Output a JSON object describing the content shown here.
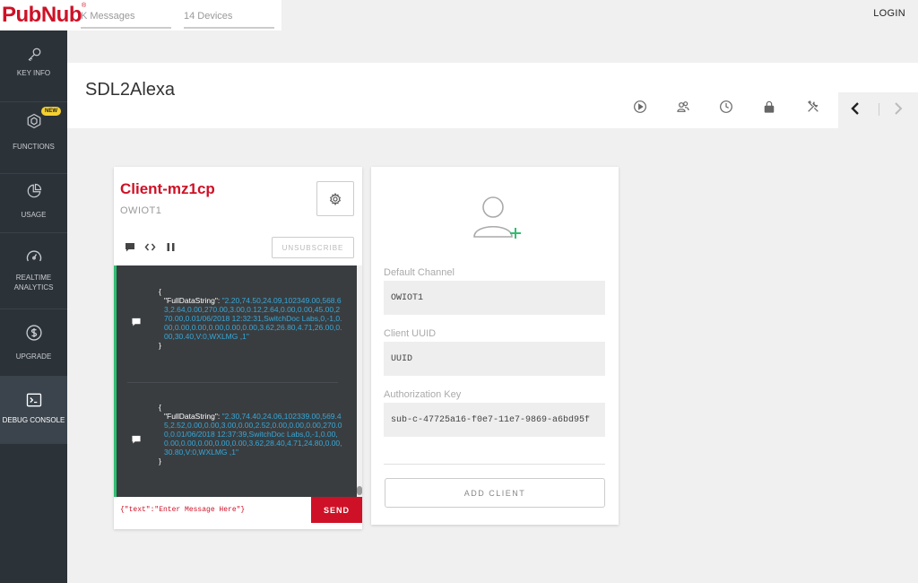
{
  "brand": {
    "logo_text": "PubNub",
    "logo_mark": "®"
  },
  "top_stats": [
    {
      "label": "K Messages"
    },
    {
      "label": "14 Devices"
    }
  ],
  "top_actions": {
    "login_label": "LOGIN"
  },
  "sidebar": {
    "items": [
      {
        "label": "KEY INFO",
        "icon": "key-icon"
      },
      {
        "label": "FUNCTIONS",
        "icon": "functions-icon",
        "badge": "NEW"
      },
      {
        "label": "USAGE",
        "icon": "pie-chart-icon"
      },
      {
        "label": "REALTIME ANALYTICS",
        "icon": "gauge-icon"
      },
      {
        "label": "UPGRADE",
        "icon": "dollar-icon"
      },
      {
        "label": "DEBUG CONSOLE",
        "icon": "terminal-icon",
        "active": true
      }
    ]
  },
  "header": {
    "title": "SDL2Alexa",
    "tools": [
      "play-icon",
      "users-icon",
      "clock-icon",
      "lock-icon",
      "tools-icon"
    ]
  },
  "client": {
    "title": "Client-mz1cp",
    "channel": "OWIOT1",
    "unsubscribe_label": "UNSUBSCRIBE",
    "messages": [
      {
        "open": "{",
        "key": "\"FullDataString\": ",
        "value": "\"2.20,74.50,24.09,102349.00,568.63,2.64,0.00,270.00,3.00,0.12,2.64,0.00,0.00,45.00,270.00,0.01/06/2018 12:32:31,SwitchDoc Labs,0,-1,0.00,0.00,0.00,0.00,0.00,0.00,3.62,26.80,4.71,26.00,0.00,30.40,V:0,WXLMG ,1\"",
        "close": "}"
      },
      {
        "open": "{",
        "key": "\"FullDataString\": ",
        "value": "\"2.30,74.40,24.06,102339.00,569.45,2.52,0.00,0.00,3.00,0.00,2.52,0.00,0.00,0.00,270.00,0.01/06/2018 12:37:39,SwitchDoc Labs,0,-1,0.00,0.00,0.00,0.00,0.00,0.00,3.62,28.40,4.71,24.80,0.00,30.80,V:0,WXLMG ,1\"",
        "close": "}"
      }
    ],
    "message_input": "{\"text\":\"Enter Message Here\"}",
    "send_label": "SEND"
  },
  "add_client": {
    "default_channel_label": "Default Channel",
    "default_channel_value": "OWIOT1",
    "uuid_label": "Client UUID",
    "uuid_value": "UUID",
    "auth_label": "Authorization Key",
    "auth_value": "sub-c-47725a16-f0e7-11e7-9869-a6bd95f",
    "add_label": "ADD CLIENT"
  },
  "colors": {
    "brand_red": "#ce1126",
    "sidebar_bg": "#2b3238",
    "console_bg": "#3a3d40",
    "console_accent": "#2fbf71",
    "json_value": "#35a8d8",
    "badge_yellow": "#f5d130",
    "add_user_plus": "#2fbf71"
  }
}
